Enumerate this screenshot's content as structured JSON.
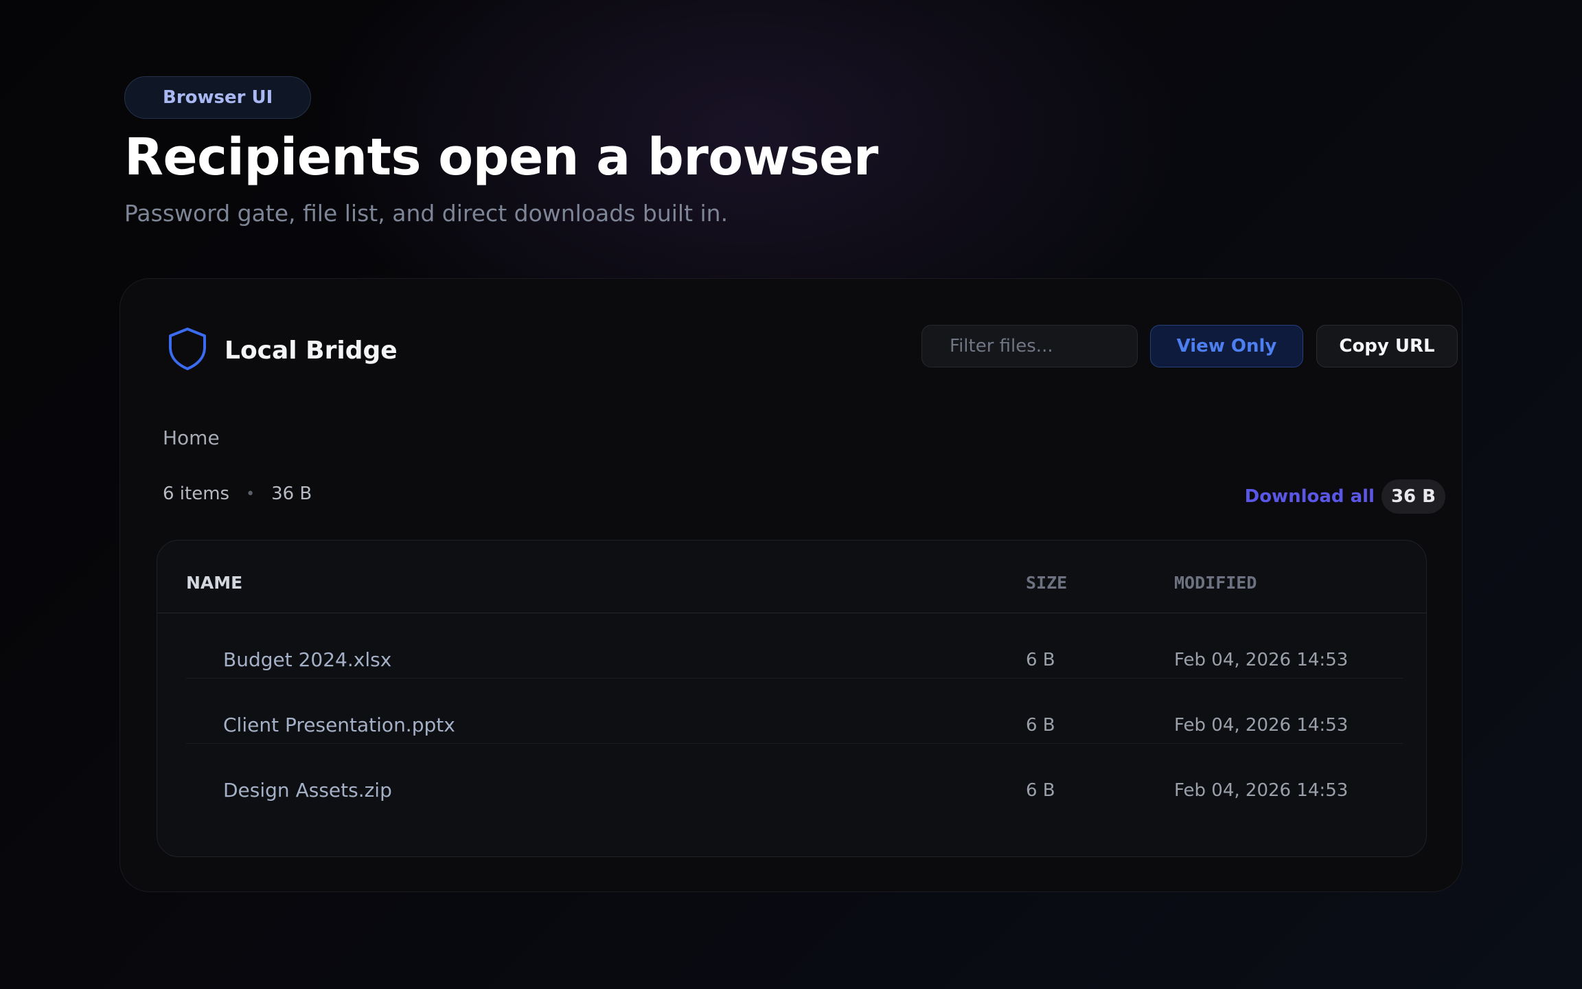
{
  "hero": {
    "badge": "Browser UI",
    "title": "Recipients open a browser",
    "subtitle": "Password gate, file list, and direct downloads built in."
  },
  "app": {
    "name": "Local Bridge",
    "brand_icon": "shield-icon",
    "accent_color": "#3b6cf0"
  },
  "toolbar": {
    "filter_placeholder": "Filter files...",
    "view_only_label": "View Only",
    "copy_url_label": "Copy URL"
  },
  "breadcrumb": {
    "current": "Home"
  },
  "summary": {
    "items": "6 items",
    "separator": "•",
    "total_size": "36 B",
    "download_all_label": "Download all",
    "download_all_size": "36 B"
  },
  "table": {
    "columns": [
      "NAME",
      "SIZE",
      "MODIFIED"
    ],
    "rows": [
      {
        "name": "Budget 2024.xlsx",
        "size": "6 B",
        "modified": "Feb 04, 2026 14:53"
      },
      {
        "name": "Client Presentation.pptx",
        "size": "6 B",
        "modified": "Feb 04, 2026 14:53"
      },
      {
        "name": "Design Assets.zip",
        "size": "6 B",
        "modified": "Feb 04, 2026 14:53"
      }
    ]
  }
}
